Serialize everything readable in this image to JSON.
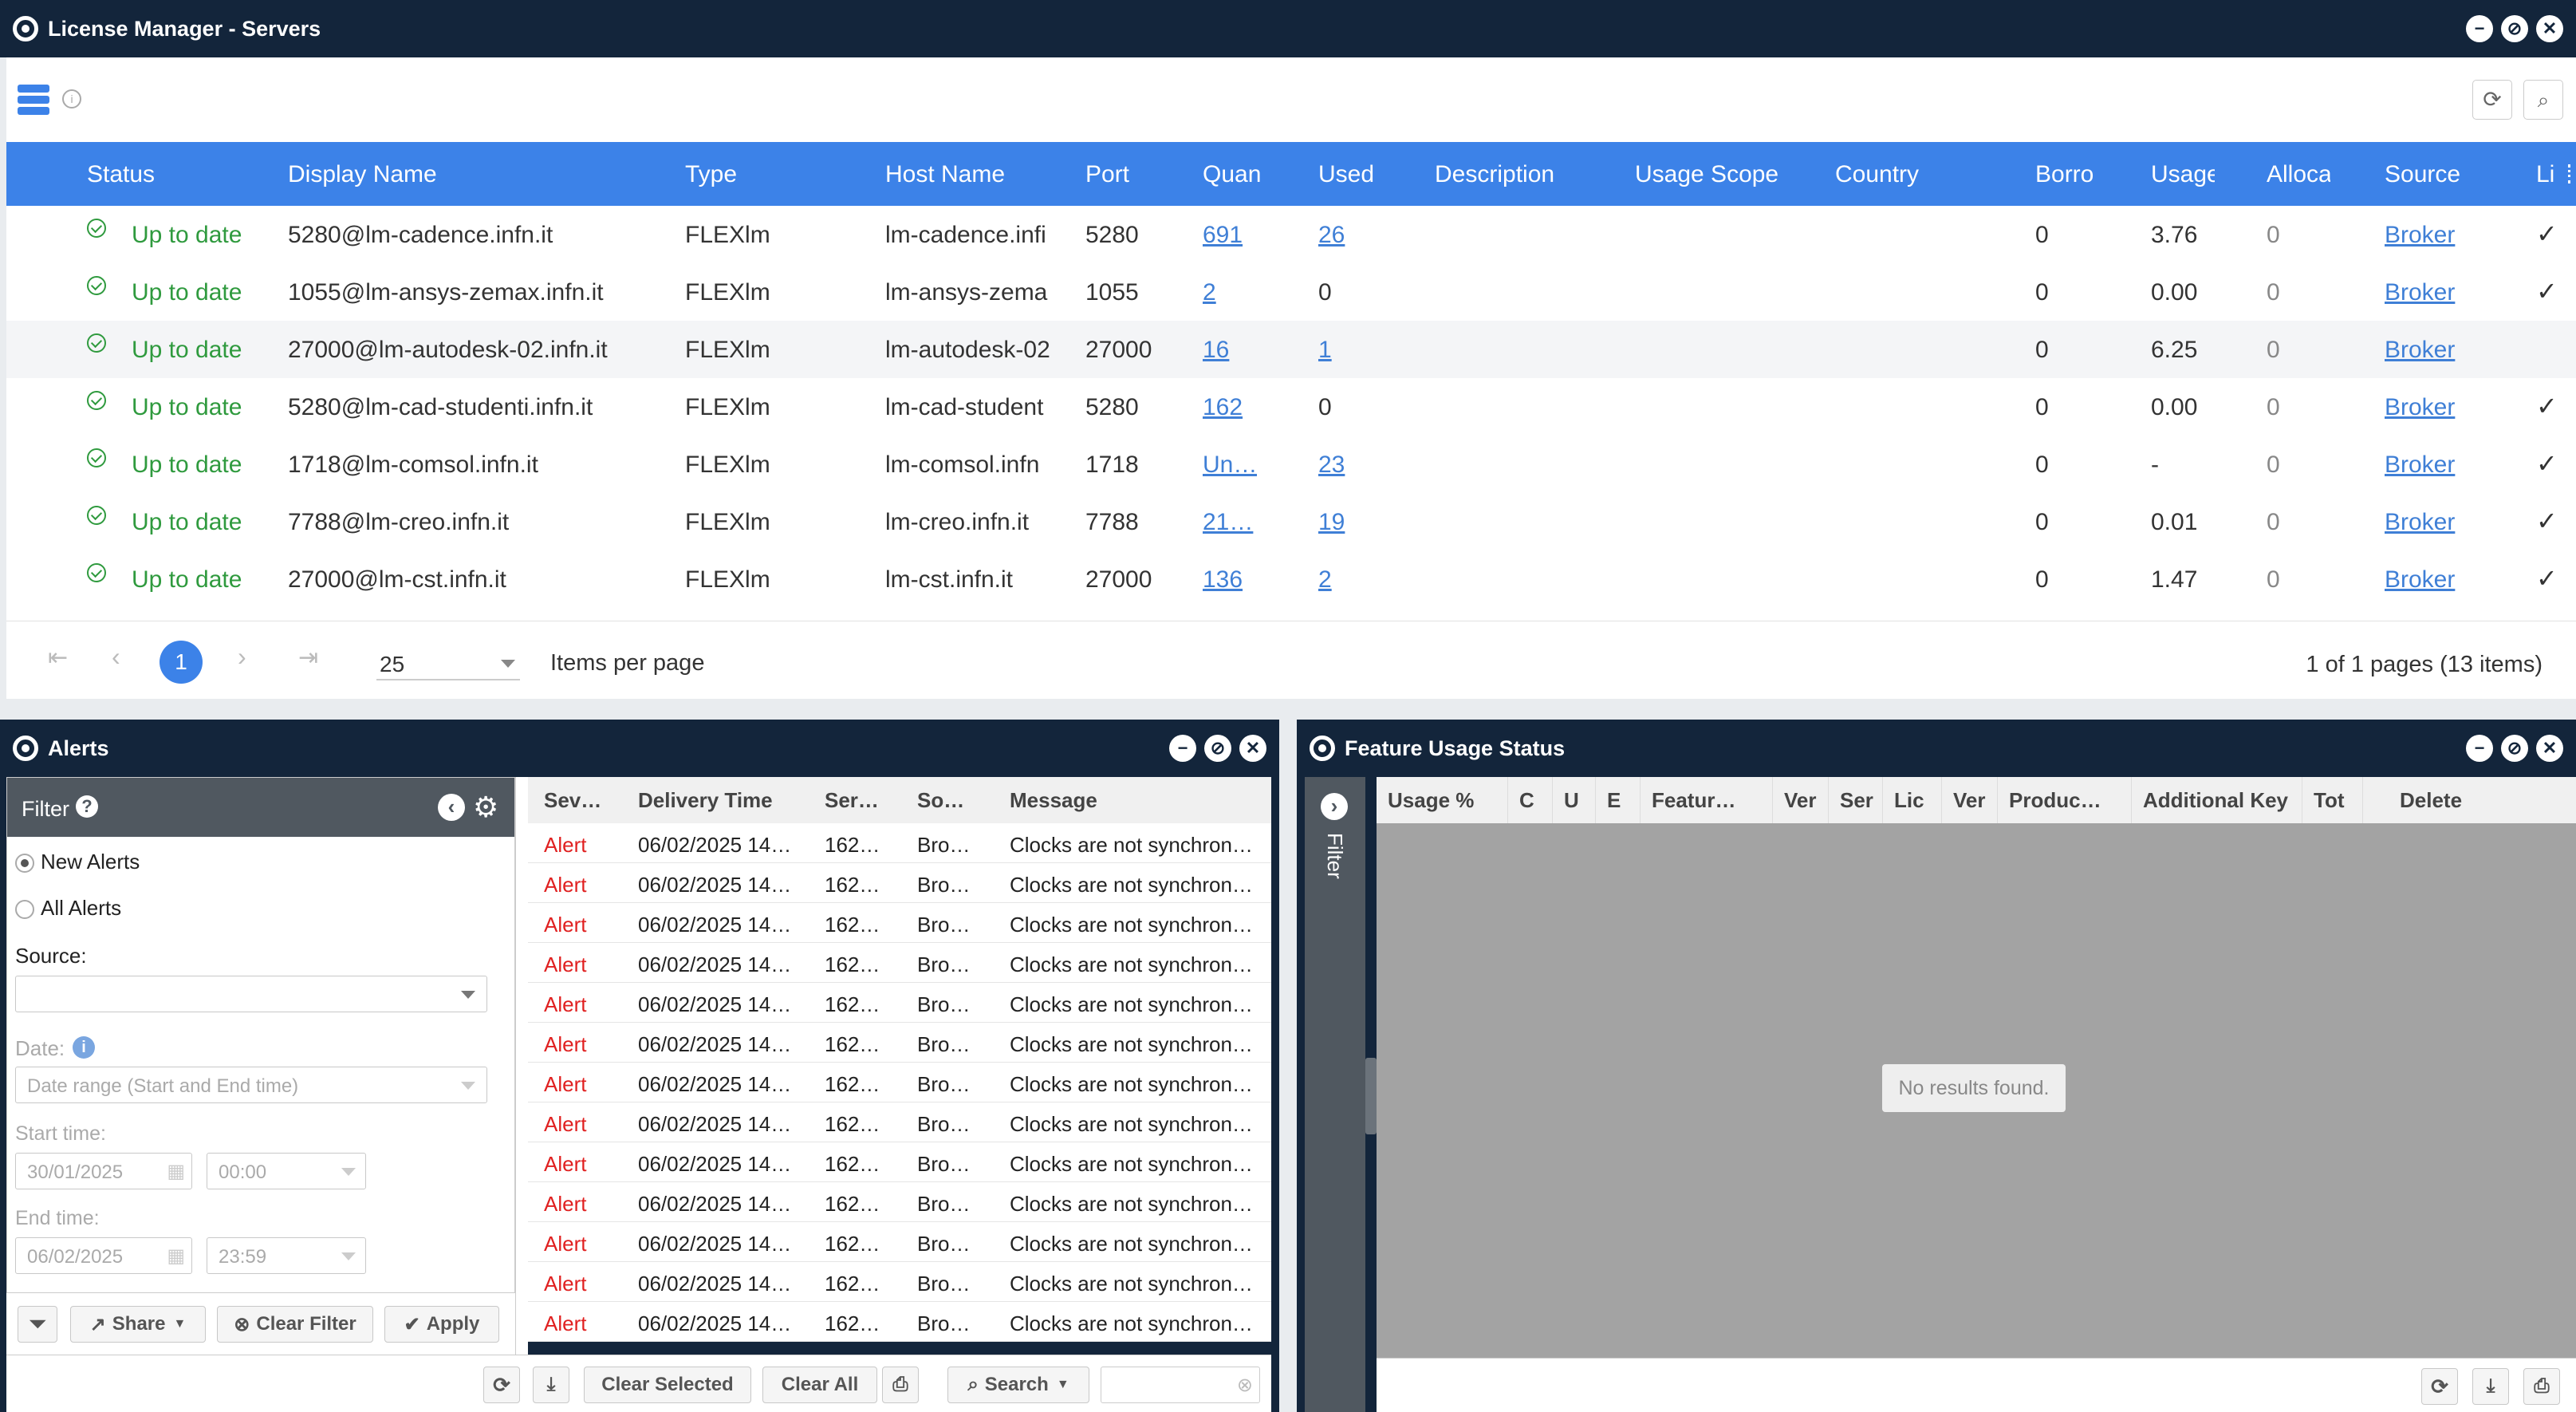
{
  "servers_window": {
    "title": "License Manager - Servers",
    "columns": [
      "Status",
      "Display Name",
      "Type",
      "Host Name",
      "Port",
      "Quan",
      "Used",
      "Description",
      "Usage Scope",
      "Country",
      "Borro",
      "Usage",
      "Alloca",
      "Source",
      "Li"
    ],
    "rows": [
      {
        "status": "Up to date",
        "display_name": "5280@lm-cadence.infn.it",
        "type": "FLEXlm",
        "host": "lm-cadence.infi",
        "port": "5280",
        "quantity": "691",
        "used": "26",
        "used_link": true,
        "borrowed": "0",
        "usage": "3.76",
        "allocated": "0",
        "source": "Broker",
        "check": true
      },
      {
        "status": "Up to date",
        "display_name": "1055@lm-ansys-zemax.infn.it",
        "type": "FLEXlm",
        "host": "lm-ansys-zema",
        "port": "1055",
        "quantity": "2",
        "used": "0",
        "used_link": false,
        "borrowed": "0",
        "usage": "0.00",
        "allocated": "0",
        "source": "Broker",
        "check": true
      },
      {
        "status": "Up to date",
        "display_name": "27000@lm-autodesk-02.infn.it",
        "type": "FLEXlm",
        "host": "lm-autodesk-02",
        "port": "27000",
        "quantity": "16",
        "used": "1",
        "used_link": true,
        "borrowed": "0",
        "usage": "6.25",
        "allocated": "0",
        "source": "Broker",
        "check": false
      },
      {
        "status": "Up to date",
        "display_name": "5280@lm-cad-studenti.infn.it",
        "type": "FLEXlm",
        "host": "lm-cad-student",
        "port": "5280",
        "quantity": "162",
        "used": "0",
        "used_link": false,
        "borrowed": "0",
        "usage": "0.00",
        "allocated": "0",
        "source": "Broker",
        "check": true
      },
      {
        "status": "Up to date",
        "display_name": "1718@lm-comsol.infn.it",
        "type": "FLEXlm",
        "host": "lm-comsol.infn",
        "port": "1718",
        "quantity": "Un…",
        "used": "23",
        "used_link": true,
        "borrowed": "0",
        "usage": "-",
        "allocated": "0",
        "source": "Broker",
        "check": true
      },
      {
        "status": "Up to date",
        "display_name": "7788@lm-creo.infn.it",
        "type": "FLEXlm",
        "host": "lm-creo.infn.it",
        "port": "7788",
        "quantity": "21…",
        "used": "19",
        "used_link": true,
        "borrowed": "0",
        "usage": "0.01",
        "allocated": "0",
        "source": "Broker",
        "check": true
      },
      {
        "status": "Up to date",
        "display_name": "27000@lm-cst.infn.it",
        "type": "FLEXlm",
        "host": "lm-cst.infn.it",
        "port": "27000",
        "quantity": "136",
        "used": "2",
        "used_link": true,
        "borrowed": "0",
        "usage": "1.47",
        "allocated": "0",
        "source": "Broker",
        "check": true
      }
    ],
    "pager": {
      "current_page": "1",
      "page_size": "25",
      "items_per_page_label": "Items per page",
      "summary": "1 of 1 pages (13 items)"
    }
  },
  "alerts_window": {
    "title": "Alerts",
    "filter": {
      "title": "Filter",
      "new_alerts": "New Alerts",
      "all_alerts": "All Alerts",
      "source_label": "Source:",
      "date_label": "Date:",
      "date_value": "Date range (Start and End time)",
      "start_label": "Start time:",
      "start_date": "30/01/2025",
      "start_time": "00:00",
      "end_label": "End time:",
      "end_date": "06/02/2025",
      "end_time": "23:59",
      "share": "Share",
      "clear_filter": "Clear Filter",
      "apply": "Apply"
    },
    "columns": [
      "Sev…",
      "Delivery Time",
      "Ser…",
      "So…",
      "Message"
    ],
    "rows": [
      {
        "sev": "Alert",
        "time": "06/02/2025 14…",
        "server": "162…",
        "source": "Bro…",
        "message": "Clocks are not synchron…"
      },
      {
        "sev": "Alert",
        "time": "06/02/2025 14…",
        "server": "162…",
        "source": "Bro…",
        "message": "Clocks are not synchron…"
      },
      {
        "sev": "Alert",
        "time": "06/02/2025 14…",
        "server": "162…",
        "source": "Bro…",
        "message": "Clocks are not synchron…"
      },
      {
        "sev": "Alert",
        "time": "06/02/2025 14…",
        "server": "162…",
        "source": "Bro…",
        "message": "Clocks are not synchron…"
      },
      {
        "sev": "Alert",
        "time": "06/02/2025 14…",
        "server": "162…",
        "source": "Bro…",
        "message": "Clocks are not synchron…"
      },
      {
        "sev": "Alert",
        "time": "06/02/2025 14…",
        "server": "162…",
        "source": "Bro…",
        "message": "Clocks are not synchron…"
      },
      {
        "sev": "Alert",
        "time": "06/02/2025 14…",
        "server": "162…",
        "source": "Bro…",
        "message": "Clocks are not synchron…"
      },
      {
        "sev": "Alert",
        "time": "06/02/2025 14…",
        "server": "162…",
        "source": "Bro…",
        "message": "Clocks are not synchron…"
      },
      {
        "sev": "Alert",
        "time": "06/02/2025 14…",
        "server": "162…",
        "source": "Bro…",
        "message": "Clocks are not synchron…"
      },
      {
        "sev": "Alert",
        "time": "06/02/2025 14…",
        "server": "162…",
        "source": "Bro…",
        "message": "Clocks are not synchron…"
      },
      {
        "sev": "Alert",
        "time": "06/02/2025 14…",
        "server": "162…",
        "source": "Bro…",
        "message": "Clocks are not synchron…"
      },
      {
        "sev": "Alert",
        "time": "06/02/2025 14…",
        "server": "162…",
        "source": "Bro…",
        "message": "Clocks are not synchron…"
      },
      {
        "sev": "Alert",
        "time": "06/02/2025 14…",
        "server": "162…",
        "source": "Bro…",
        "message": "Clocks are not synchron…"
      }
    ],
    "toolbar": {
      "clear_selected": "Clear Selected",
      "clear_all": "Clear All",
      "search": "Search"
    }
  },
  "feature_window": {
    "title": "Feature Usage Status",
    "filter_tab": "Filter",
    "columns": [
      "Usage %",
      "C",
      "U",
      "E",
      "Featur…",
      "Ver",
      "Ser",
      "Lic",
      "Ver",
      "Produc…",
      "Additional Key",
      "Tot",
      "Delete"
    ],
    "empty_message": "No results found."
  },
  "colors": {
    "titlebar": "#13253b",
    "header_blue": "#3c82e8",
    "ok_green": "#2f9a3e",
    "alert_red": "#e02020",
    "link": "#3f7fd6",
    "empty_area": "#a3a3a3"
  }
}
